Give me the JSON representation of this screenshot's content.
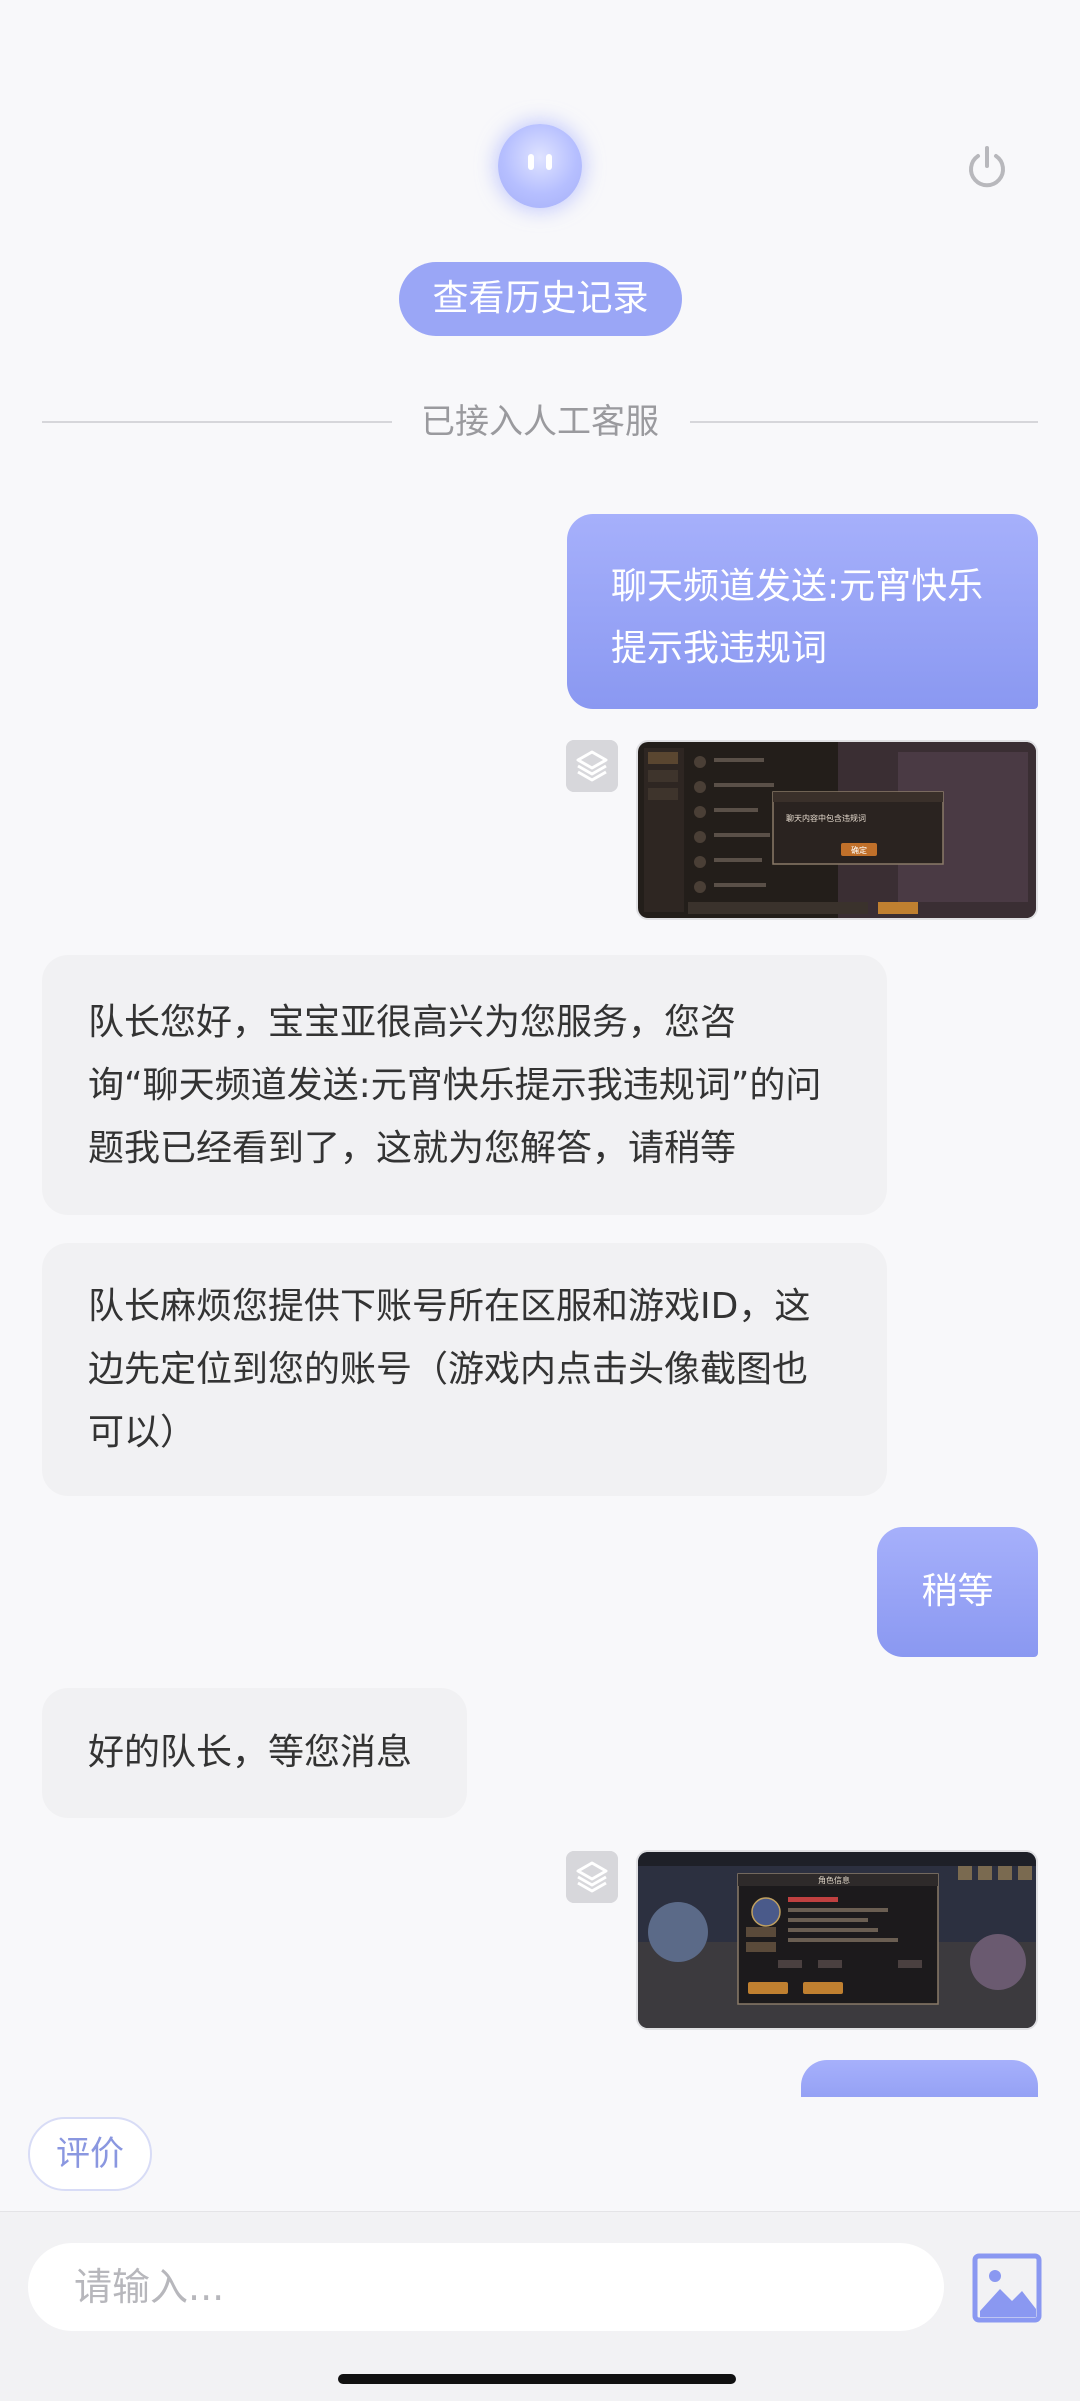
{
  "header": {
    "history_label": "查看历史记录"
  },
  "divider": {
    "text": "已接入人工客服"
  },
  "messages": {
    "m1": {
      "line1": "聊天频道发送:元宵快乐",
      "line2": "提示我违规词"
    },
    "m3": {
      "line1": "队长您好，宝宝亚很高兴为您服务，您咨",
      "line2": "询“聊天频道发送:元宵快乐提示我违规词”的问",
      "line3": "题我已经看到了，这就为您解答，请稍等"
    },
    "m4": {
      "line1": "队长麻烦您提供下账号所在区服和游戏ID，这",
      "line2": "边先定位到您的账号（游戏内点击头像截图也",
      "line3": "可以）"
    },
    "m5": {
      "text": "稍等"
    },
    "m6": {
      "text": "好的队长，等您消息"
    }
  },
  "thumb1": {
    "dialog_text": "聊天内容中包含违规词",
    "dialog_button": "确定"
  },
  "thumb2": {
    "panel_title": "角色信息"
  },
  "footer": {
    "rate_label": "评价",
    "input_placeholder": "请输入..."
  },
  "colors": {
    "accent": "#8a98f1",
    "bubble_left": "#f1f1f3",
    "history_btn": "#9aa6f6"
  },
  "icons": [
    "assistant-avatar-icon",
    "power-icon",
    "layers-icon",
    "image-icon"
  ]
}
